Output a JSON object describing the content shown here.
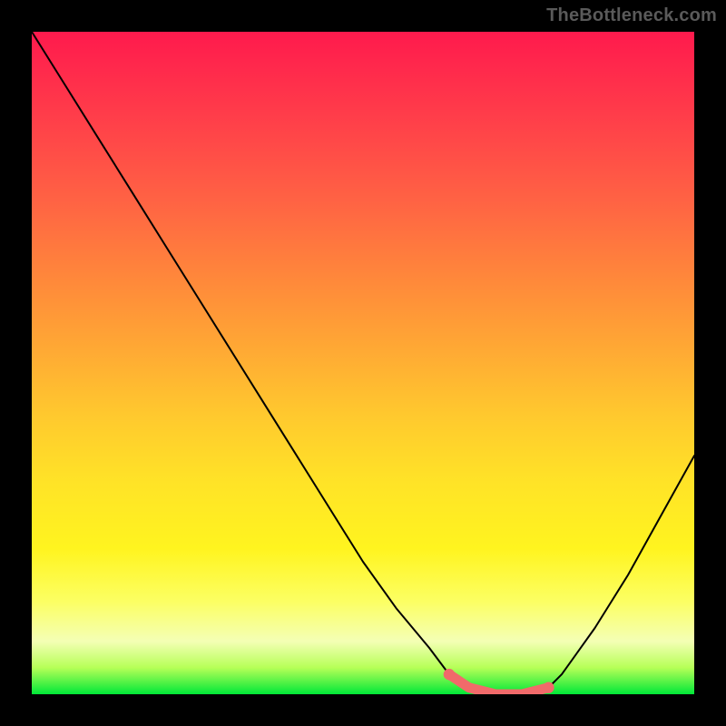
{
  "attribution": "TheBottleneck.com",
  "chart_data": {
    "type": "line",
    "title": "",
    "xlabel": "",
    "ylabel": "",
    "xlim": [
      0,
      100
    ],
    "ylim": [
      0,
      100
    ],
    "grid": false,
    "series": [
      {
        "name": "bottleneck-curve",
        "x": [
          0,
          5,
          10,
          15,
          20,
          25,
          30,
          35,
          40,
          45,
          50,
          55,
          60,
          63,
          66,
          70,
          74,
          78,
          80,
          85,
          90,
          95,
          100
        ],
        "y": [
          100,
          92,
          84,
          76,
          68,
          60,
          52,
          44,
          36,
          28,
          20,
          13,
          7,
          3,
          1,
          0,
          0,
          1,
          3,
          10,
          18,
          27,
          36
        ]
      }
    ],
    "highlight_segment": {
      "name": "optimal-range",
      "color": "#f16a6a",
      "x": [
        63,
        66,
        70,
        74,
        78
      ],
      "y": [
        3,
        1,
        0,
        0,
        1
      ]
    },
    "background_gradient_stops": [
      {
        "pos": 0,
        "color": "#ff1a4d"
      },
      {
        "pos": 25,
        "color": "#ff6144"
      },
      {
        "pos": 58,
        "color": "#ffc92e"
      },
      {
        "pos": 86,
        "color": "#fcff63"
      },
      {
        "pos": 100,
        "color": "#00e838"
      }
    ]
  }
}
